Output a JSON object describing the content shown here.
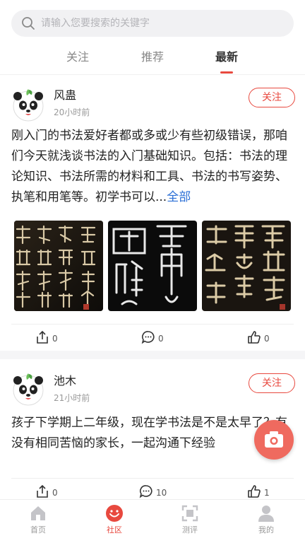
{
  "search": {
    "placeholder": "请输入您要搜索的关键字"
  },
  "tabs": [
    {
      "label": "关注",
      "active": false
    },
    {
      "label": "推荐",
      "active": false
    },
    {
      "label": "最新",
      "active": true
    }
  ],
  "posts": [
    {
      "author": "风蛊",
      "time": "20小时前",
      "follow_label": "关注",
      "text": "刚入门的书法爱好者都或多或少有些初级错误，那咱们今天就浅谈书法的入门基础知识。包括：书法的理论知识、书法所需的材料和工具、书法的书写姿势、执笔和用笔等。初学书可以...",
      "more_label": "全部",
      "images": [
        {
          "name": "calligraphy-regular-script",
          "glyph_rows": [
            "西颜",
            "京真",
            "千卿",
            "福书"
          ]
        },
        {
          "name": "calligraphy-seal-script",
          "glyph_rows": [
            "国上",
            "雜帝"
          ]
        },
        {
          "name": "calligraphy-clerical-script",
          "glyph_rows": [
            "留谦",
            "之遷",
            "吾字"
          ]
        }
      ],
      "share_count": "0",
      "comment_count": "0",
      "like_count": "0"
    },
    {
      "author": "池木",
      "time": "21小时前",
      "follow_label": "关注",
      "text": "孩子下学期上二年级，现在学书法是不是太早了？有没有相同苦恼的家长，一起沟通下经验",
      "share_count": "0",
      "comment_count": "10",
      "like_count": "1"
    }
  ],
  "nav": [
    {
      "label": "首页",
      "icon": "home-icon",
      "active": false
    },
    {
      "label": "社区",
      "icon": "community-icon",
      "active": true
    },
    {
      "label": "测评",
      "icon": "scan-icon",
      "active": false
    },
    {
      "label": "我的",
      "icon": "profile-icon",
      "active": false
    }
  ],
  "colors": {
    "accent": "#e8493f",
    "fab": "#ef6a5f",
    "link": "#2b6fd6"
  },
  "fab_icon": "camera-icon"
}
